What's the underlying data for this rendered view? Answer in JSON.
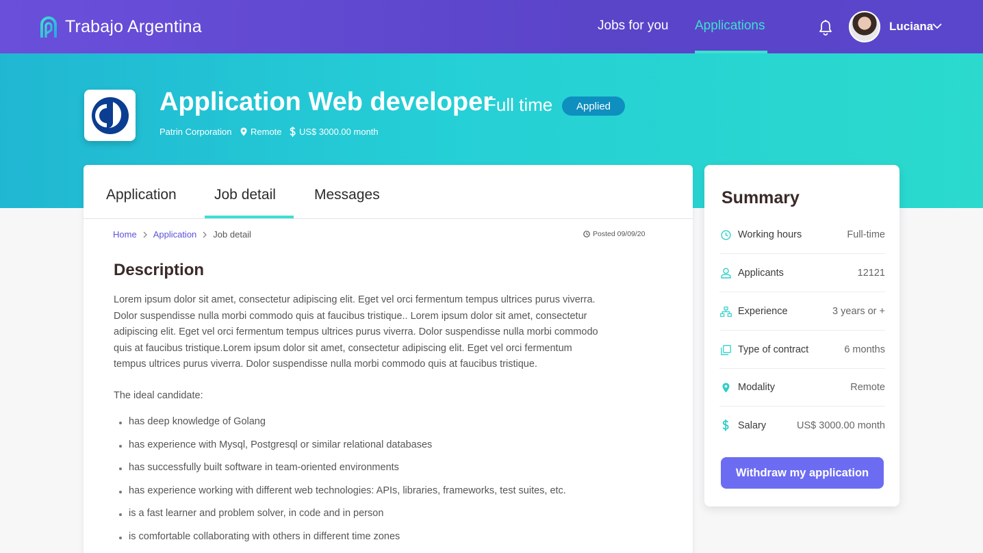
{
  "brand": {
    "name": "Trabajo Argentina"
  },
  "nav": {
    "jobs_label": "Jobs for you",
    "applications_label": "Applications",
    "user_name": "Luciana"
  },
  "job": {
    "title": "Application Web developer",
    "type": "Full time",
    "status": "Applied",
    "company": "Patrin Corporation",
    "location": "Remote",
    "salary": "US$ 3000.00 month"
  },
  "tabs": [
    {
      "label": "Application"
    },
    {
      "label": "Job detail"
    },
    {
      "label": "Messages"
    }
  ],
  "breadcrumb": {
    "home": "Home",
    "application": "Application",
    "current": "Job detail"
  },
  "posted": "Posted 09/09/20",
  "description": {
    "title": "Description",
    "body": "Lorem ipsum dolor sit amet, consectetur adipiscing elit. Eget vel orci fermentum tempus ultrices purus viverra. Dolor suspendisse nulla morbi commodo quis at faucibus tristique.. Lorem ipsum dolor sit amet, consectetur adipiscing elit. Eget vel orci fermentum tempus ultrices purus viverra. Dolor suspendisse nulla morbi commodo quis at faucibus tristique.Lorem ipsum dolor sit amet, consectetur adipiscing elit. Eget vel orci fermentum tempus ultrices purus viverra. Dolor suspendisse nulla morbi commodo quis at faucibus tristique.",
    "ideal_intro": "The ideal candidate:",
    "requirements": [
      "has deep knowledge of Golang",
      "has experience with Mysql, Postgresql or similar relational databases",
      "has successfully built software in team-oriented environments",
      "has experience working with different web technologies: APIs, libraries, frameworks, test suites, etc.",
      "is a fast learner and problem solver, in code and in person",
      "is comfortable collaborating with others in different time zones"
    ]
  },
  "summary": {
    "title": "Summary",
    "rows": [
      {
        "label": "Working hours",
        "value": "Full-time",
        "icon": "clock-icon"
      },
      {
        "label": "Applicants",
        "value": "12121",
        "icon": "user-icon"
      },
      {
        "label": "Experience",
        "value": "3 years or +",
        "icon": "hierarchy-icon"
      },
      {
        "label": "Type of contract",
        "value": "6 months",
        "icon": "copy-icon"
      },
      {
        "label": "Modality",
        "value": "Remote",
        "icon": "location-pin-icon"
      },
      {
        "label": "Salary",
        "value": "US$ 3000.00 month",
        "icon": "dollar-icon"
      }
    ],
    "withdraw_label": "Withdraw my application"
  },
  "colors": {
    "nav_bg": "#5a44c8",
    "accent_teal": "#3ee0cf",
    "hero_start": "#20b7d2",
    "hero_end": "#2bdacd",
    "status_pill": "#0e8fbf",
    "link": "#5b53d6",
    "button": "#6c6cf2"
  }
}
